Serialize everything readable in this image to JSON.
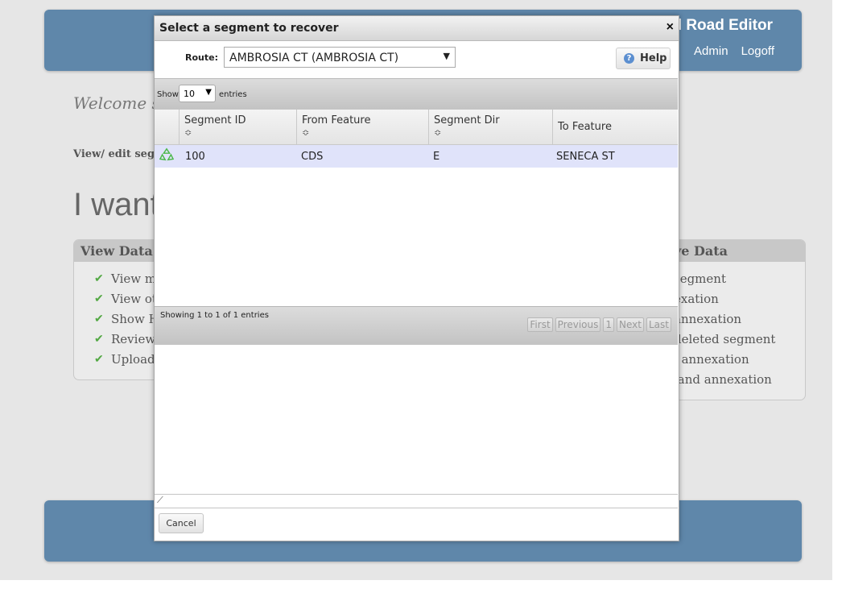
{
  "header": {
    "app_title": "l Road Editor",
    "links": [
      "Admin",
      "Logoff"
    ]
  },
  "page": {
    "welcome": "Welcome ste",
    "view_edit": "View/ edit segm",
    "i_want": "I want"
  },
  "left_panel": {
    "title": "View Data",
    "items": [
      "View m",
      "View ot",
      "Show H",
      "Review",
      "Upload"
    ]
  },
  "right_panel": {
    "title": "ve Data",
    "items": [
      "segment",
      "exation",
      "annexation",
      "deleted segment",
      "l annexation",
      "land annexation"
    ]
  },
  "dialog": {
    "title": "Select a segment to recover",
    "close_glyph": "×",
    "route_label": "Route:",
    "route_value": "AMBROSIA CT (AMBROSIA CT)",
    "help_label": "Help",
    "show_label": "Show",
    "entries_value": "10",
    "entries_label": "entries",
    "columns": [
      "Segment ID",
      "From Feature",
      "Segment Dir",
      "To Feature"
    ],
    "rows": [
      {
        "segment_id": "100",
        "from_feature": "CDS",
        "segment_dir": "E",
        "to_feature": "SENECA ST"
      }
    ],
    "showing_text": "Showing 1 to 1 of 1 entries",
    "pager": [
      "First",
      "Previous",
      "1",
      "Next",
      "Last"
    ],
    "cancel_label": "Cancel"
  },
  "colors": {
    "header_bar": "#5f87aa",
    "selected_row": "#e0e3fa",
    "check": "#52a843",
    "recycle": "#4bb84b"
  },
  "icons": {
    "close": "close-icon",
    "help": "help-icon",
    "recover": "recycle-icon",
    "check": "checkmark-icon",
    "sort": "sort-icon"
  }
}
